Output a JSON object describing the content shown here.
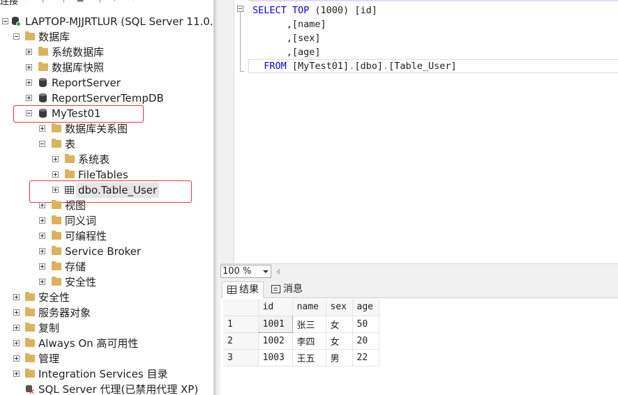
{
  "explorer": {
    "toolbar": {
      "connect_label": "连接"
    },
    "server": "LAPTOP-MJJRTLUR (SQL Server 11.0.",
    "databases_folder": "数据库",
    "system_databases": "系统数据库",
    "snapshots": "数据库快照",
    "db_reportserver": "ReportServer",
    "db_reportservertemp": "ReportServerTempDB",
    "db_mytest": "MyTest01",
    "diagrams": "数据库关系图",
    "tables": "表",
    "system_tables": "系统表",
    "file_tables": "FileTables",
    "table_user": "dbo.Table_User",
    "views": "视图",
    "synonyms": "同义词",
    "programmability": "可编程性",
    "service_broker": "Service Broker",
    "storage": "存储",
    "db_security": "安全性",
    "security": "安全性",
    "server_objects": "服务器对象",
    "replication": "复制",
    "always_on": "Always On 高可用性",
    "management": "管理",
    "integration_services": "Integration Services 目录",
    "sql_agent": "SQL Server 代理(已禁用代理 XP)"
  },
  "editor": {
    "line1_select": "SELECT TOP",
    "line1_top": " (1000) ",
    "line1_id": "[id]",
    "line2": "      ,[name]",
    "line3": "      ,[sex]",
    "line4": "      ,[age]",
    "line5_from": "  FROM ",
    "line5_db": "[MyTest01]",
    "line5_dot1": ".",
    "line5_schema": "[dbo]",
    "line5_dot2": ".",
    "line5_table": "[Table_User]"
  },
  "zoom": {
    "value": "100 %"
  },
  "results": {
    "tab_results": "结果",
    "tab_messages": "消息",
    "columns": [
      "id",
      "name",
      "sex",
      "age"
    ],
    "rows": [
      {
        "num": "1",
        "id": "1001",
        "name": "张三",
        "sex": "女",
        "age": "50"
      },
      {
        "num": "2",
        "id": "1002",
        "name": "李四",
        "sex": "女",
        "age": "20"
      },
      {
        "num": "3",
        "id": "1003",
        "name": "王五",
        "sex": "男",
        "age": "22"
      }
    ]
  },
  "colors": {
    "highlight": "#e8383d",
    "keyword": "#0000ff",
    "folder": "#dcb35c"
  }
}
